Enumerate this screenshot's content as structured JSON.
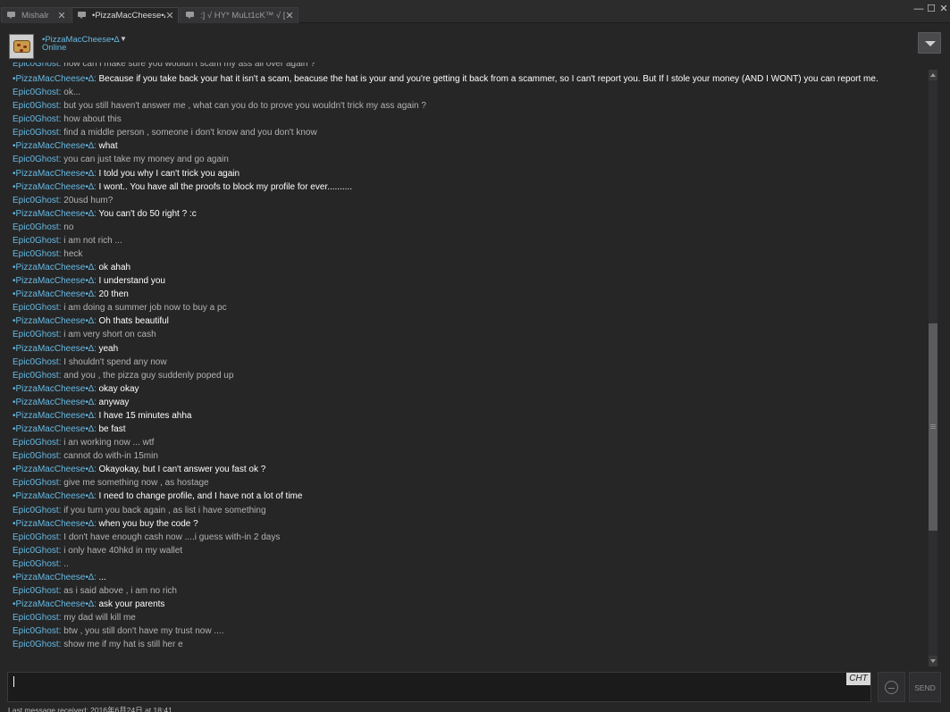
{
  "tabs": [
    {
      "label": "Mishalr",
      "close": "✕",
      "active": false
    },
    {
      "label": "•PizzaMacCheese•∆",
      "close": "✕",
      "active": true
    },
    {
      "label": ":] √ HY* MuLt1cK™ √ [:",
      "close": "✕",
      "active": false
    }
  ],
  "window_controls": {
    "minimize": "—",
    "maximize": "☐",
    "close": "✕"
  },
  "header": {
    "friend_name": "•PizzaMacCheese•∆",
    "status": "Online",
    "caret": "▼"
  },
  "colors": {
    "background": "#262627",
    "name_link": "#66b8e0",
    "self_text": "#ffffff",
    "other_text": "#b3b3b3"
  },
  "messages": [
    {
      "sender": "Epic0Ghost",
      "text": "how can i make sure you wouldn't scam my ass all over again ?",
      "self": false
    },
    {
      "sender": "•PizzaMacCheese•∆",
      "text": "Because if you take back your hat it isn't a scam, beacuse the hat is your and you're getting it back from a scammer, so I can't report you. But If I stole your money (AND I WONT) you can report me.",
      "self": true
    },
    {
      "sender": "Epic0Ghost",
      "text": "ok...",
      "self": false
    },
    {
      "sender": "Epic0Ghost",
      "text": "but you still haven't answer me , what can you do to prove you wouldn't trick my ass again ?",
      "self": false
    },
    {
      "sender": "Epic0Ghost",
      "text": "how about this",
      "self": false
    },
    {
      "sender": "Epic0Ghost",
      "text": "find a middle person , someone i don't know and you don't know",
      "self": false
    },
    {
      "sender": "•PizzaMacCheese•∆",
      "text": "what",
      "self": true
    },
    {
      "sender": "Epic0Ghost",
      "text": "you can just take my money and go again",
      "self": false
    },
    {
      "sender": "•PizzaMacCheese•∆",
      "text": "I told you why I can't trick you again",
      "self": true
    },
    {
      "sender": "•PizzaMacCheese•∆",
      "text": "I wont.. You have all the proofs to block my profile for ever..........",
      "self": true
    },
    {
      "sender": "Epic0Ghost",
      "text": "20usd hum?",
      "self": false
    },
    {
      "sender": "•PizzaMacCheese•∆",
      "text": "You can't do 50 right ? :c",
      "self": true
    },
    {
      "sender": "Epic0Ghost",
      "text": "no",
      "self": false
    },
    {
      "sender": "Epic0Ghost",
      "text": "i am not rich ...",
      "self": false
    },
    {
      "sender": "Epic0Ghost",
      "text": "heck",
      "self": false
    },
    {
      "sender": "•PizzaMacCheese•∆",
      "text": "ok ahah",
      "self": true
    },
    {
      "sender": "•PizzaMacCheese•∆",
      "text": "I understand you",
      "self": true
    },
    {
      "sender": "•PizzaMacCheese•∆",
      "text": "20 then",
      "self": true
    },
    {
      "sender": "Epic0Ghost",
      "text": "i am doing a summer job now to buy a pc",
      "self": false
    },
    {
      "sender": "•PizzaMacCheese•∆",
      "text": "Oh thats beautiful",
      "self": true
    },
    {
      "sender": "Epic0Ghost",
      "text": "i am very short on cash",
      "self": false
    },
    {
      "sender": "•PizzaMacCheese•∆",
      "text": "yeah",
      "self": true
    },
    {
      "sender": "Epic0Ghost",
      "text": "I shouldn't spend any now",
      "self": false
    },
    {
      "sender": "Epic0Ghost",
      "text": "and you , the pizza guy suddenly poped up",
      "self": false
    },
    {
      "sender": "•PizzaMacCheese•∆",
      "text": "okay okay",
      "self": true
    },
    {
      "sender": "•PizzaMacCheese•∆",
      "text": "anyway",
      "self": true
    },
    {
      "sender": "•PizzaMacCheese•∆",
      "text": "I have 15 minutes ahha",
      "self": true
    },
    {
      "sender": "•PizzaMacCheese•∆",
      "text": "be fast",
      "self": true
    },
    {
      "sender": "Epic0Ghost",
      "text": "i an working now ... wtf",
      "self": false
    },
    {
      "sender": "Epic0Ghost",
      "text": "cannot do with-in 15min",
      "self": false
    },
    {
      "sender": "•PizzaMacCheese•∆",
      "text": "Okayokay, but I can't answer you fast ok ?",
      "self": true
    },
    {
      "sender": "Epic0Ghost",
      "text": "give me something now , as hostage",
      "self": false
    },
    {
      "sender": "•PizzaMacCheese•∆",
      "text": "I need to change profile, and I have not a lot of time",
      "self": true
    },
    {
      "sender": "Epic0Ghost",
      "text": "if you turn you back again , as list i have something",
      "self": false
    },
    {
      "sender": "•PizzaMacCheese•∆",
      "text": "when you buy the code ?",
      "self": true
    },
    {
      "sender": "Epic0Ghost",
      "text": "I don't have enough cash now ....i guess with-in 2 days",
      "self": false
    },
    {
      "sender": "Epic0Ghost",
      "text": "i only have 40hkd in my wallet",
      "self": false
    },
    {
      "sender": "Epic0Ghost",
      "text": "..",
      "self": false
    },
    {
      "sender": "•PizzaMacCheese•∆",
      "text": "...",
      "self": true
    },
    {
      "sender": "Epic0Ghost",
      "text": "as i said above , i am no rich",
      "self": false
    },
    {
      "sender": "•PizzaMacCheese•∆",
      "text": "ask your parents",
      "self": true
    },
    {
      "sender": "Epic0Ghost",
      "text": "my dad will kill me",
      "self": false
    },
    {
      "sender": "Epic0Ghost",
      "text": "btw , you still don't have my trust now ....",
      "self": false
    },
    {
      "sender": "Epic0Ghost",
      "text": "show me if my hat is still her e",
      "self": false
    }
  ],
  "scroll": {
    "position": 0.66,
    "thumb_fraction": 0.36
  },
  "composer": {
    "value": "",
    "ime_indicator": "CHT",
    "send_label": "SEND"
  },
  "footer": {
    "last_message": "Last message received: 2016年6月24日 at 18:41"
  }
}
